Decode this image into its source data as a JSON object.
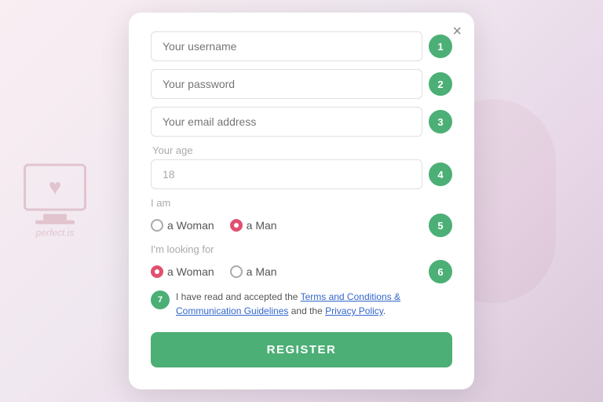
{
  "background": {
    "color_start": "#f9eef2",
    "color_end": "#d8c8d8"
  },
  "modal": {
    "close_label": "×",
    "fields": {
      "username": {
        "placeholder": "Your username",
        "step": "1"
      },
      "password": {
        "placeholder": "Your password",
        "step": "2"
      },
      "email": {
        "placeholder": "Your email address",
        "step": "3"
      },
      "age": {
        "label": "Your age",
        "value": "18",
        "step": "4"
      }
    },
    "gender_i_am": {
      "label": "I am",
      "step": "5",
      "options": [
        {
          "id": "iam-woman",
          "label": "a Woman",
          "selected": false
        },
        {
          "id": "iam-man",
          "label": "a Man",
          "selected": true
        }
      ]
    },
    "gender_looking_for": {
      "label": "I'm looking for",
      "step": "6",
      "options": [
        {
          "id": "look-woman",
          "label": "a Woman",
          "selected": true
        },
        {
          "id": "look-man",
          "label": "a Man",
          "selected": false
        }
      ]
    },
    "terms": {
      "step": "7",
      "text_before": "I have read and accepted the ",
      "link1": "Terms and Conditions & Communication Guidelines",
      "text_between": " and the ",
      "link2": "Privacy Policy",
      "text_after": "."
    },
    "register_button": "REGISTER"
  },
  "watermark": {
    "text": "perfect.is"
  }
}
